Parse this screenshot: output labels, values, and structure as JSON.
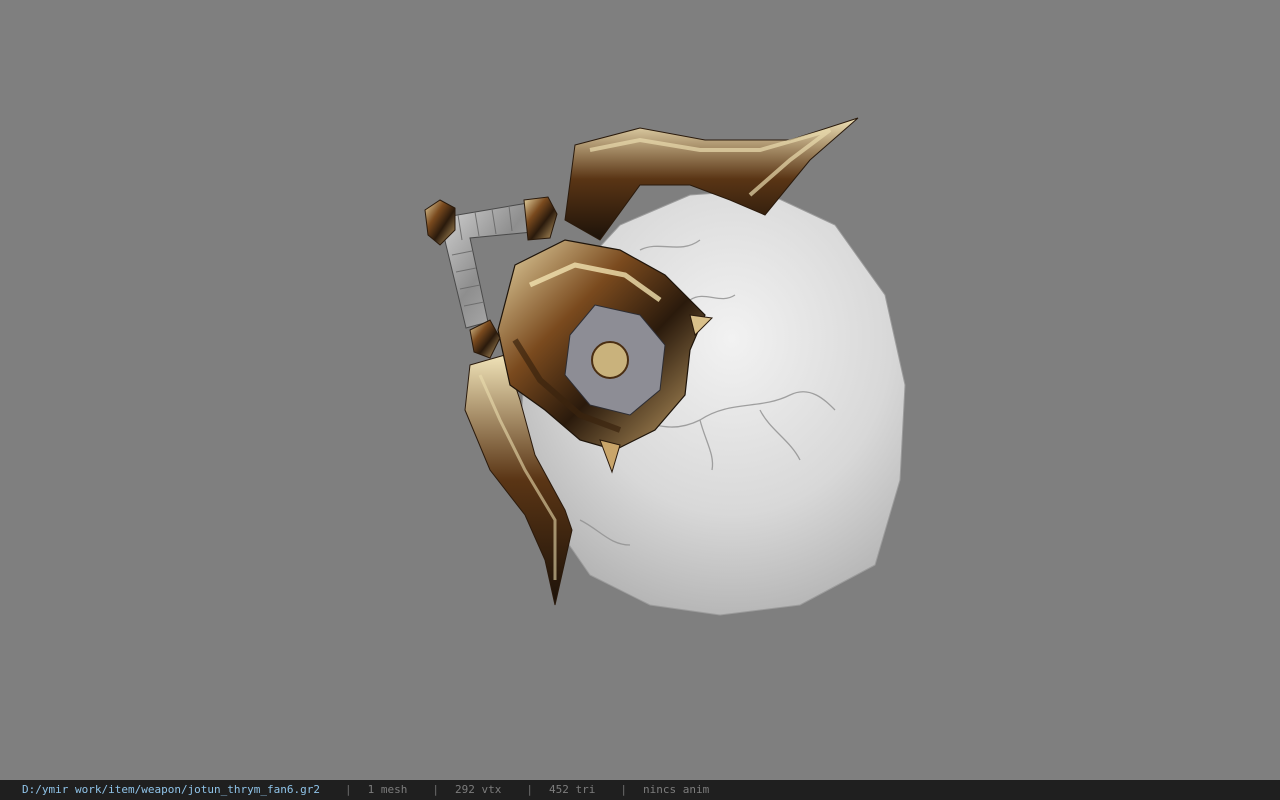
{
  "viewer": {
    "background_color": "#7f7f7f",
    "model": {
      "name": "jotun_thrym_fan6",
      "description_icon": "weapon-model"
    }
  },
  "statusbar": {
    "file_path": "D:/ymir work/item/weapon/jotun_thrym_fan6.gr2",
    "separator": "|",
    "mesh_count": "1 mesh",
    "vertex_count": "292 vtx",
    "triangle_count": "452 tri",
    "animation": "nincs anim",
    "colors": {
      "background": "#1f1f1f",
      "path": "#8fc3e8",
      "text": "#7d7d7d"
    }
  }
}
